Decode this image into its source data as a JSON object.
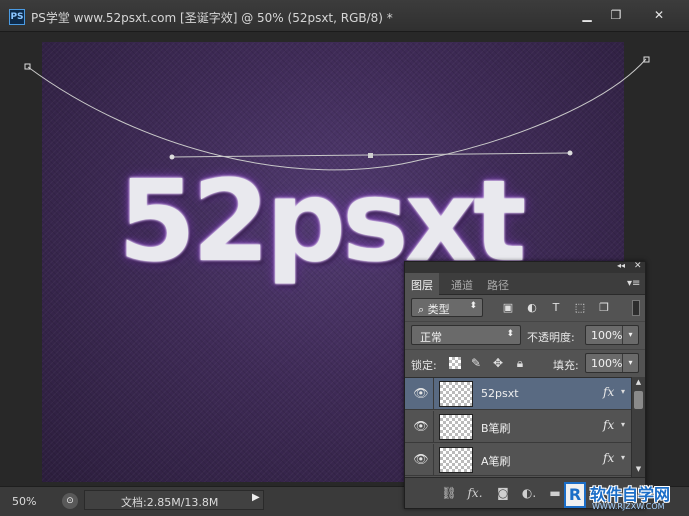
{
  "window": {
    "app_icon": "PS",
    "title": "PS学堂 www.52psxt.com [圣诞字效] @ 50% (52psxt, RGB/8) *",
    "controls": {
      "minimize": "▁",
      "maximize": "❐",
      "close": "✕"
    }
  },
  "canvas": {
    "art_text": "52psxt"
  },
  "statusbar": {
    "zoom": "50%",
    "doc_info": "文档:2.85M/13.8M",
    "arrow": "▶"
  },
  "layers_panel": {
    "collapse": "◂◂",
    "close": "✕",
    "menu": "▾≡",
    "tabs": [
      {
        "label": "图层",
        "active": true
      },
      {
        "label": "通道",
        "active": false
      },
      {
        "label": "路径",
        "active": false
      }
    ],
    "filter": {
      "search_glyph": "⌕",
      "label": "类型",
      "arrow": "⬍"
    },
    "filter_icons": [
      "image-filter-icon",
      "adjustment-filter-icon",
      "type-filter-icon",
      "shape-filter-icon",
      "smart-object-filter-icon"
    ],
    "blend_mode": {
      "value": "正常",
      "arrow": "⬍"
    },
    "opacity": {
      "label": "不透明度:",
      "value": "100%",
      "arrow": "▾"
    },
    "lock": {
      "label": "锁定:"
    },
    "fill": {
      "label": "填充:",
      "value": "100%",
      "arrow": "▾"
    },
    "layers": [
      {
        "name": "52psxt",
        "fx": "fx",
        "selected": true
      },
      {
        "name": "B笔刷",
        "fx": "fx",
        "selected": false
      },
      {
        "name": "A笔刷",
        "fx": "fx",
        "selected": false
      }
    ],
    "footer_icons": [
      "link-icon",
      "fx-icon",
      "mask-icon",
      "adjustment-icon",
      "folder-icon"
    ]
  },
  "watermark": {
    "logo": "R",
    "title": "软件自学网",
    "url": "WWW.RJZXW.COM"
  },
  "colors": {
    "canvas_purple": "#3f2b57",
    "selected_layer": "#596a82",
    "panel_bg": "#535353",
    "brand_blue": "#1c6ec7"
  }
}
